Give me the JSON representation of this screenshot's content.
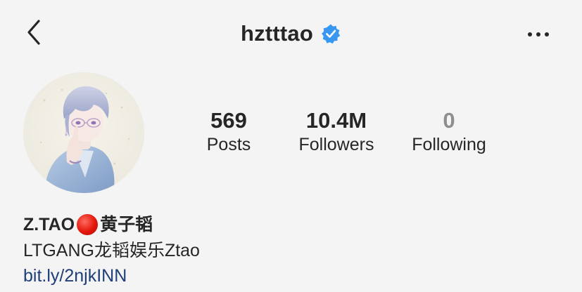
{
  "header": {
    "username": "hzttta o",
    "verified": true,
    "back_icon": "chevron-left-icon",
    "more_icon": "more-horizontal-icon",
    "verified_icon": "verified-badge-icon",
    "verified_color": "#3897f0"
  },
  "profile": {
    "avatar_icon": "avatar",
    "stats": [
      {
        "value": "569",
        "label": "Posts"
      },
      {
        "value": "10.4M",
        "label": "Followers"
      },
      {
        "value": "0",
        "label": "Following"
      }
    ]
  },
  "bio": {
    "name_prefix": "Z.TAO",
    "name_emoji": "red-circle-icon",
    "name_suffix": "黄子韬",
    "line": "LTGANG龙韬娱乐Ztao",
    "link": "bit.ly/2njkINN"
  },
  "colors": {
    "background": "#f4f4f4",
    "text": "#262626",
    "muted": "#8e8e8e",
    "link": "#1f3f78"
  }
}
